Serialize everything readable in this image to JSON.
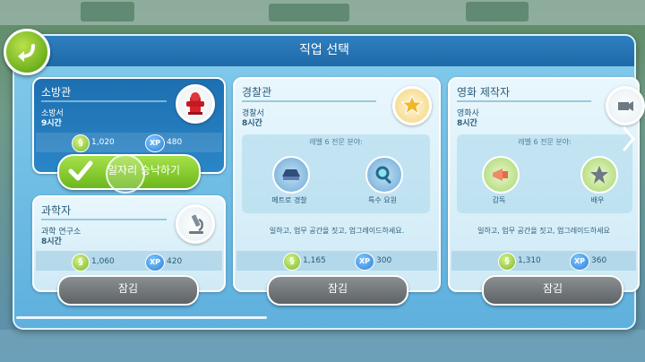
{
  "window": {
    "title": "직업 선택"
  },
  "cards": [
    {
      "title": "소방관",
      "workplace": "소방서",
      "hours": "9시간",
      "coins": "1,020",
      "xp": "480",
      "icon": "fire-hydrant-icon",
      "accept_label": "일자리 승낙하기"
    },
    {
      "title": "과학자",
      "workplace": "과학 연구소",
      "hours": "8시간",
      "coins": "1,060",
      "xp": "420",
      "icon": "microscope-icon",
      "button_label": "잠김"
    },
    {
      "title": "경찰관",
      "workplace": "경찰서",
      "hours": "8시간",
      "requirement_title": "레벨 6 전문 분야:",
      "specialties": [
        "메트로 경찰",
        "특수 요원"
      ],
      "hint": "일하고, 업무 공간을 짓고, 업그레이드하세요.",
      "coins": "1,165",
      "xp": "300",
      "icon": "police-badge-icon",
      "button_label": "잠김"
    },
    {
      "title": "영화 제작자",
      "workplace": "영화사",
      "hours": "8시간",
      "requirement_title": "레벨 6 전문 분야:",
      "specialties": [
        "감독",
        "배우"
      ],
      "hint": "일하고, 업무 공간을 짓고, 업그레이드하세요",
      "coins": "1,310",
      "xp": "360",
      "icon": "film-camera-icon",
      "button_label": "잠김"
    }
  ],
  "currency": {
    "coin_symbol": "§",
    "xp_symbol": "XP"
  },
  "colors": {
    "header": "#1f6aa8",
    "accept": "#6cb81e",
    "locked": "#5e6366",
    "selected_card": "#1d6fb0"
  }
}
